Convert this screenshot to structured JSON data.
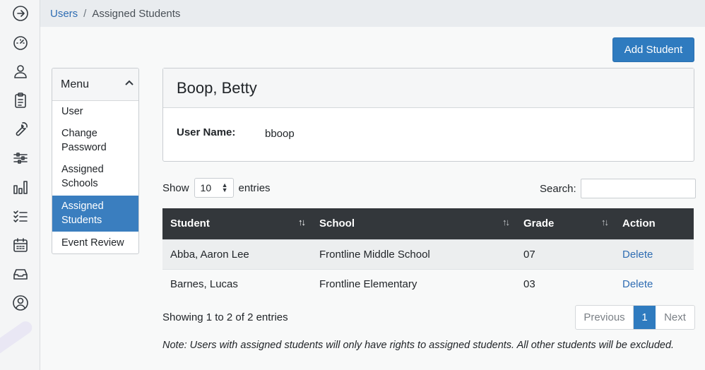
{
  "sidebar": {
    "icons": [
      "arrow-right-circle-icon",
      "dashboard-gauge-icon",
      "user-icon",
      "clipboard-icon",
      "wrench-icon",
      "sliders-icon",
      "bar-chart-icon",
      "checklist-icon",
      "calendar-icon",
      "inbox-icon",
      "support-icon"
    ]
  },
  "breadcrumb": {
    "parent": "Users",
    "separator": "/",
    "current": "Assigned Students"
  },
  "toolbar": {
    "add_label": "Add Student"
  },
  "menu": {
    "title": "Menu",
    "items": [
      {
        "label": "User",
        "active": false
      },
      {
        "label": "Change Password",
        "active": false
      },
      {
        "label": "Assigned Schools",
        "active": false
      },
      {
        "label": "Assigned Students",
        "active": true
      },
      {
        "label": "Event Review",
        "active": false
      }
    ]
  },
  "profile": {
    "name": "Boop, Betty",
    "username_label": "User Name:",
    "username": "bboop"
  },
  "table_controls": {
    "show_label": "Show",
    "entries_value": "10",
    "entries_label": "entries",
    "search_label": "Search:",
    "search_value": ""
  },
  "table": {
    "headers": [
      "Student",
      "School",
      "Grade",
      "Action"
    ],
    "rows": [
      {
        "student": "Abba, Aaron Lee",
        "school": "Frontline Middle School",
        "grade": "07",
        "action": "Delete"
      },
      {
        "student": "Barnes, Lucas",
        "school": "Frontline Elementary",
        "grade": "03",
        "action": "Delete"
      }
    ]
  },
  "info": "Showing 1 to 2 of 2 entries",
  "pagination": {
    "previous": "Previous",
    "page": "1",
    "next": "Next"
  },
  "note": "Note: Users with assigned students will only have rights to assigned students. All other students will be excluded.",
  "colors": {
    "primary": "#2f7bbf",
    "table_header": "#33373b",
    "link": "#2f6db3"
  }
}
